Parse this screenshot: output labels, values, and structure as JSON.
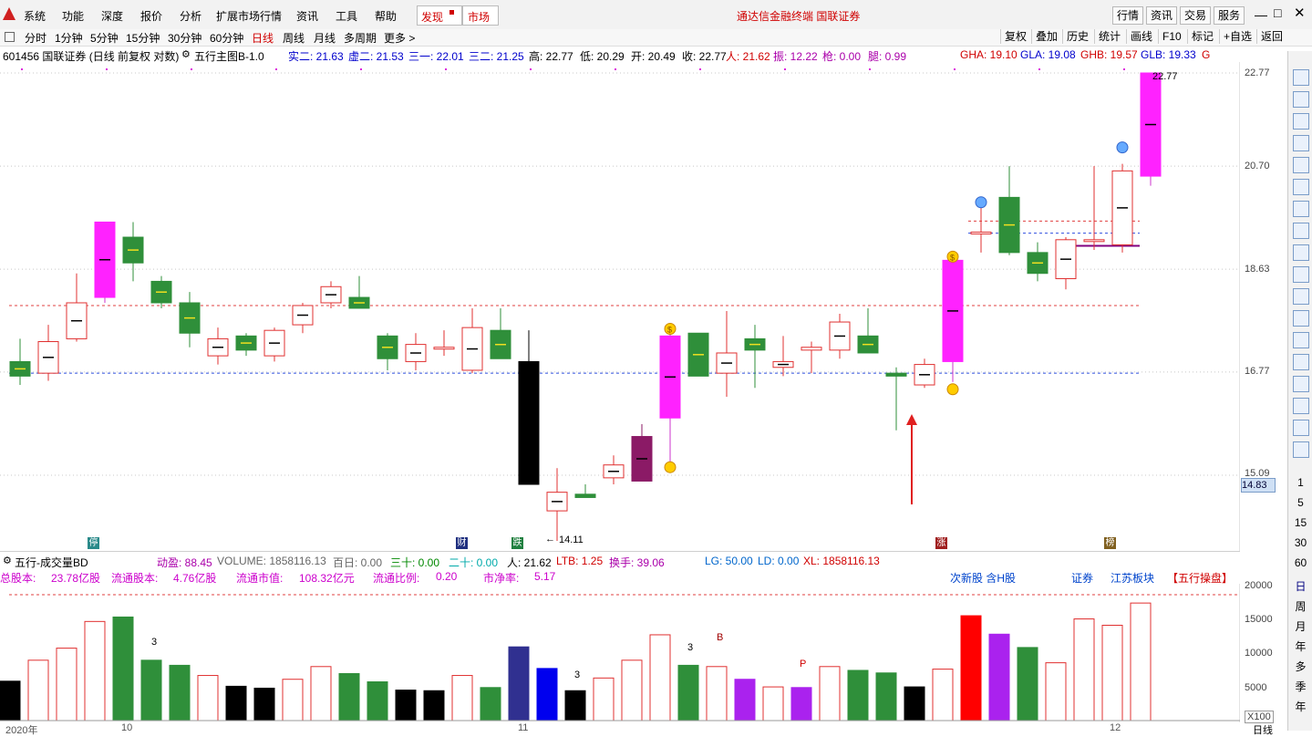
{
  "menu": {
    "items": [
      "系统",
      "功能",
      "深度",
      "报价",
      "分析",
      "扩展市场行情",
      "资讯",
      "工具",
      "帮助"
    ],
    "discover": "发现",
    "market": "市场",
    "center_title": "通达信金融终端 国联证券",
    "right_buttons": [
      "行情",
      "资讯",
      "交易",
      "服务"
    ]
  },
  "periods": {
    "items": [
      "分时",
      "1分钟",
      "5分钟",
      "15分钟",
      "30分钟",
      "60分钟",
      "日线",
      "周线",
      "月线",
      "多周期",
      "更多 >"
    ],
    "active": "日线",
    "tools": [
      "复权",
      "叠加",
      "历史",
      "统计",
      "画线",
      "F10",
      "标记",
      "+自选",
      "返回"
    ]
  },
  "info": {
    "stock": "601456 国联证券 (日线 前复权 对数)",
    "indicator": "五行主图B-1.0",
    "shi_er": "实二: 21.63",
    "xu_er": "虚二: 21.53",
    "san_yi": "三一: 22.01",
    "san_er": "三二: 21.25",
    "high": "高: 22.77",
    "low": "低: 20.29",
    "open": "开: 20.49",
    "close": "收: 22.77",
    "ren": "人: 21.62",
    "zhen": "振: 12.22",
    "qiang": "枪: 0.00",
    "tui": "腿: 0.99",
    "gha": "GHA: 19.10",
    "gla": "GLA: 19.08",
    "ghb": "GHB: 19.57",
    "glb": "GLB: 19.33",
    "g": "G"
  },
  "price_axis": {
    "labels": [
      "22.77",
      "20.70",
      "18.63",
      "16.77",
      "15.09"
    ],
    "current": "14.83",
    "high_label": "22.77",
    "low_label": "14.11"
  },
  "markers": {
    "ting": "停",
    "cai": "财",
    "die": "跌",
    "zhang": "涨",
    "bang": "榜",
    "dollar": "$"
  },
  "volume_header": {
    "name": "五行-成交量BD",
    "dongying": "动盈: 88.45",
    "volume": "VOLUME: 1858116.13",
    "bairi": "百日: 0.00",
    "sanshi": "三十: 0.00",
    "ershi": "二十: 0.00",
    "ren": "人: 21.62",
    "ltb": "LTB: 1.25",
    "huanshou": "换手: 39.06",
    "lg": "LG: 50.00",
    "ld": "LD: 0.00",
    "xl": "XL: 1858116.13"
  },
  "stats": {
    "zongguben": "总股本:",
    "zongguben_v": "23.78亿股",
    "liutong": "流通股本:",
    "liutong_v": "4.76亿股",
    "shizhi": "流通市值:",
    "shizhi_v": "108.32亿元",
    "bili": "流通比例:",
    "bili_v": "0.20",
    "jingl": "市净率:",
    "jingl_v": "5.17",
    "tags": [
      "次新股 含H股",
      "证券",
      "江苏板块",
      "【五行操盘】"
    ]
  },
  "volume_axis": {
    "labels": [
      "20000",
      "15000",
      "10000",
      "5000"
    ],
    "unit": "X100"
  },
  "vol_annotations": [
    "3",
    "3",
    "3",
    "B",
    "P"
  ],
  "x_axis": [
    "2020年",
    "10",
    "11",
    "12"
  ],
  "x_axis_period": "日线",
  "sidebar": {
    "intervals": [
      "1",
      "5",
      "15",
      "30",
      "60"
    ],
    "periods": [
      "日",
      "周",
      "月",
      "年",
      "多",
      "季",
      "年"
    ],
    "icons": [
      "up-icon",
      "down-icon",
      "list-icon",
      "chart-icon",
      "trend-icon",
      "candle-icon",
      "f10-icon",
      "book-icon",
      "doc-icon",
      "f12-icon",
      "grid-icon",
      "wave-icon",
      "rsi-icon",
      "tool-icon",
      "move-icon",
      "pen-icon",
      "f5-icon",
      "refresh-icon"
    ]
  },
  "chart_data": {
    "type": "candlestick",
    "y_scale": "log",
    "ylim": [
      14.11,
      22.77
    ],
    "candles": [
      {
        "o": 16.95,
        "h": 17.35,
        "l": 16.55,
        "c": 16.7,
        "color": "green"
      },
      {
        "o": 16.75,
        "h": 17.6,
        "l": 16.62,
        "c": 17.3,
        "color": "red"
      },
      {
        "o": 17.35,
        "h": 18.55,
        "l": 17.3,
        "c": 18.0,
        "color": "red"
      },
      {
        "o": 18.1,
        "h": 19.55,
        "l": 18.0,
        "c": 19.55,
        "color": "magenta"
      },
      {
        "o": 19.25,
        "h": 19.55,
        "l": 18.4,
        "c": 18.75,
        "color": "green"
      },
      {
        "o": 18.4,
        "h": 18.5,
        "l": 17.9,
        "c": 18.0,
        "color": "green"
      },
      {
        "o": 18.0,
        "h": 18.2,
        "l": 17.2,
        "c": 17.45,
        "color": "green"
      },
      {
        "o": 17.35,
        "h": 17.55,
        "l": 16.9,
        "c": 17.05,
        "color": "red"
      },
      {
        "o": 17.4,
        "h": 17.45,
        "l": 17.05,
        "c": 17.15,
        "color": "green"
      },
      {
        "o": 17.05,
        "h": 17.55,
        "l": 16.95,
        "c": 17.5,
        "color": "red"
      },
      {
        "o": 17.6,
        "h": 18.0,
        "l": 17.45,
        "c": 17.95,
        "color": "red"
      },
      {
        "o": 18.0,
        "h": 18.4,
        "l": 17.9,
        "c": 18.3,
        "color": "red"
      },
      {
        "o": 18.1,
        "h": 18.5,
        "l": 17.9,
        "c": 17.9,
        "color": "green"
      },
      {
        "o": 17.4,
        "h": 17.45,
        "l": 16.8,
        "c": 17.0,
        "color": "green"
      },
      {
        "o": 16.95,
        "h": 17.45,
        "l": 16.8,
        "c": 17.25,
        "color": "red"
      },
      {
        "o": 17.2,
        "h": 17.5,
        "l": 17.05,
        "c": 17.2,
        "color": "red"
      },
      {
        "o": 16.8,
        "h": 17.9,
        "l": 16.75,
        "c": 17.55,
        "color": "red"
      },
      {
        "o": 17.5,
        "h": 17.9,
        "l": 17.0,
        "c": 17.0,
        "color": "green"
      },
      {
        "o": 16.95,
        "h": 17.5,
        "l": 14.95,
        "c": 14.95,
        "color": "black"
      },
      {
        "o": 14.55,
        "h": 15.2,
        "l": 14.11,
        "c": 14.83,
        "color": "red"
      },
      {
        "o": 14.8,
        "h": 14.95,
        "l": 14.75,
        "c": 14.75,
        "color": "green"
      },
      {
        "o": 15.05,
        "h": 15.4,
        "l": 14.95,
        "c": 15.25,
        "color": "red"
      },
      {
        "o": 15.0,
        "h": 15.9,
        "l": 15.0,
        "c": 15.7,
        "color": "purple"
      },
      {
        "o": 16.0,
        "h": 17.5,
        "l": 15.3,
        "c": 17.4,
        "color": "magenta"
      },
      {
        "o": 16.7,
        "h": 17.45,
        "l": 16.7,
        "c": 17.45,
        "color": "green"
      },
      {
        "o": 16.75,
        "h": 17.85,
        "l": 16.35,
        "c": 17.1,
        "color": "red"
      },
      {
        "o": 17.35,
        "h": 17.6,
        "l": 16.5,
        "c": 17.15,
        "color": "green"
      },
      {
        "o": 16.85,
        "h": 17.4,
        "l": 16.7,
        "c": 16.95,
        "color": "red"
      },
      {
        "o": 17.15,
        "h": 17.3,
        "l": 16.75,
        "c": 17.2,
        "color": "red"
      },
      {
        "o": 17.15,
        "h": 17.8,
        "l": 17.0,
        "c": 17.65,
        "color": "red"
      },
      {
        "o": 17.4,
        "h": 17.9,
        "l": 17.1,
        "c": 17.1,
        "color": "green"
      },
      {
        "o": 16.75,
        "h": 16.85,
        "l": 15.8,
        "c": 16.7,
        "color": "green"
      },
      {
        "o": 16.55,
        "h": 17.0,
        "l": 16.5,
        "c": 16.9,
        "color": "red"
      },
      {
        "o": 16.95,
        "h": 18.8,
        "l": 16.6,
        "c": 18.8,
        "color": "magenta"
      },
      {
        "o": 19.35,
        "h": 19.85,
        "l": 18.95,
        "c": 19.35,
        "color": "red"
      },
      {
        "o": 20.05,
        "h": 20.7,
        "l": 18.9,
        "c": 18.95,
        "color": "green"
      },
      {
        "o": 18.95,
        "h": 19.15,
        "l": 18.4,
        "c": 18.55,
        "color": "green"
      },
      {
        "o": 18.45,
        "h": 19.25,
        "l": 18.25,
        "c": 19.2,
        "color": "red"
      },
      {
        "o": 19.2,
        "h": 20.7,
        "l": 19.0,
        "c": 19.2,
        "color": "red"
      },
      {
        "o": 19.1,
        "h": 20.75,
        "l": 18.95,
        "c": 20.6,
        "color": "red"
      },
      {
        "o": 20.49,
        "h": 22.77,
        "l": 20.29,
        "c": 22.77,
        "color": "magenta"
      }
    ],
    "ref_lines": [
      {
        "value": 17.95,
        "color": "#e04040"
      },
      {
        "value": 16.75,
        "color": "#3050e0"
      },
      {
        "value": 19.57,
        "color": "#e04040"
      },
      {
        "value": 19.33,
        "color": "#3050e0"
      },
      {
        "value": 19.08,
        "color": "#800080"
      }
    ],
    "volume": [
      6200,
      9500,
      11400,
      15600,
      16300,
      9500,
      8700,
      7100,
      5400,
      5100,
      6500,
      8500,
      7400,
      6100,
      4800,
      4700,
      7100,
      5200,
      11600,
      8200,
      4700,
      6700,
      9500,
      13500,
      8700,
      8500,
      6500,
      5300,
      5200,
      8500,
      7900,
      7500,
      5300,
      8100,
      16500,
      13600,
      11500,
      9100,
      16000,
      15000,
      18500
    ],
    "volume_colors": [
      "black",
      "red",
      "red",
      "red",
      "green",
      "green",
      "green",
      "red",
      "black",
      "black",
      "red",
      "red",
      "green",
      "green",
      "black",
      "black",
      "red",
      "green",
      "navy",
      "blue",
      "black",
      "red",
      "red",
      "red",
      "green",
      "red",
      "purple",
      "red",
      "purple",
      "red",
      "green",
      "green",
      "black",
      "red",
      "redfill",
      "purple",
      "green",
      "red",
      "red",
      "red",
      "red"
    ],
    "volume_ylim": [
      0,
      21000
    ]
  }
}
